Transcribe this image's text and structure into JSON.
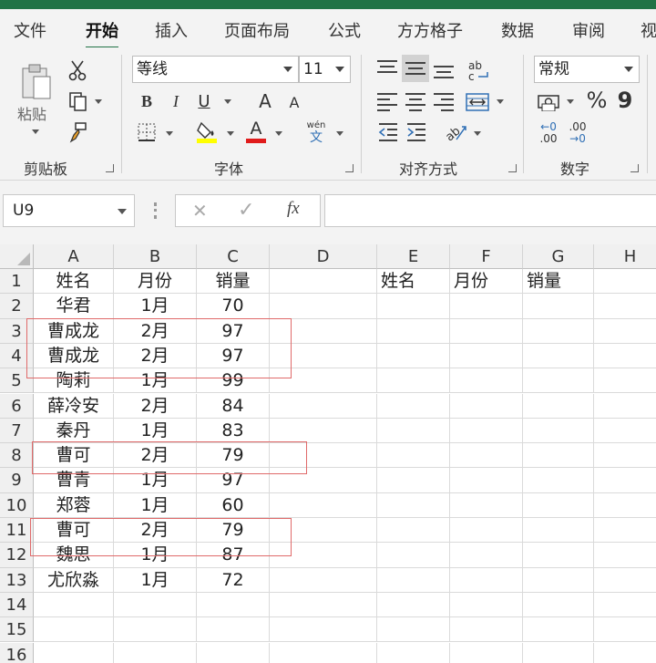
{
  "ribbon_tabs": [
    "文件",
    "开始",
    "插入",
    "页面布局",
    "公式",
    "方方格子",
    "数据",
    "审阅",
    "视"
  ],
  "active_tab": "开始",
  "accent_color": "#217346",
  "highlight_color": "#e06a6a",
  "clipboard": {
    "paste_label": "粘贴",
    "group_label": "剪贴板"
  },
  "font": {
    "name": "等线",
    "size": "11",
    "bold": "B",
    "italic": "I",
    "underline": "U",
    "grow": "A",
    "shrink": "A",
    "color_a": "A",
    "phonetic_top": "wén",
    "phonetic_bottom": "文",
    "group_label": "字体"
  },
  "alignment": {
    "group_label": "对齐方式"
  },
  "number": {
    "format": "常规",
    "percent": "%",
    "comma": "9",
    "inc_decimal_top": "←0",
    "inc_decimal_bottom": ".00",
    "dec_decimal_top": ".00",
    "dec_decimal_bottom": "→0",
    "group_label": "数字"
  },
  "formula_bar": {
    "name_box": "U9",
    "cancel": "✕",
    "enter": "✓",
    "fx": "fx",
    "content": ""
  },
  "columns": [
    "A",
    "B",
    "C",
    "D",
    "E",
    "F",
    "G",
    "H"
  ],
  "rows": [
    [
      "姓名",
      "月份",
      "销量",
      "",
      "姓名",
      "月份",
      "销量",
      ""
    ],
    [
      "华君",
      "1月",
      "70",
      "",
      "",
      "",
      "",
      ""
    ],
    [
      "曹成龙",
      "2月",
      "97",
      "",
      "",
      "",
      "",
      ""
    ],
    [
      "曹成龙",
      "2月",
      "97",
      "",
      "",
      "",
      "",
      ""
    ],
    [
      "陶莉",
      "1月",
      "99",
      "",
      "",
      "",
      "",
      ""
    ],
    [
      "薛冷安",
      "2月",
      "84",
      "",
      "",
      "",
      "",
      ""
    ],
    [
      "秦丹",
      "1月",
      "83",
      "",
      "",
      "",
      "",
      ""
    ],
    [
      "曹可",
      "2月",
      "79",
      "",
      "",
      "",
      "",
      ""
    ],
    [
      "曹青",
      "1月",
      "97",
      "",
      "",
      "",
      "",
      ""
    ],
    [
      "郑蓉",
      "1月",
      "60",
      "",
      "",
      "",
      "",
      ""
    ],
    [
      "曹可",
      "2月",
      "79",
      "",
      "",
      "",
      "",
      ""
    ],
    [
      "魏思",
      "1月",
      "87",
      "",
      "",
      "",
      "",
      ""
    ],
    [
      "尤欣淼",
      "1月",
      "72",
      "",
      "",
      "",
      "",
      ""
    ],
    [
      "",
      "",
      "",
      "",
      "",
      "",
      "",
      ""
    ],
    [
      "",
      "",
      "",
      "",
      "",
      "",
      "",
      ""
    ],
    [
      "",
      "",
      "",
      "",
      "",
      "",
      "",
      ""
    ]
  ],
  "row_numbers": [
    "1",
    "2",
    "3",
    "4",
    "5",
    "6",
    "7",
    "8",
    "9",
    "10",
    "11",
    "12",
    "13",
    "14",
    "15",
    "16"
  ]
}
